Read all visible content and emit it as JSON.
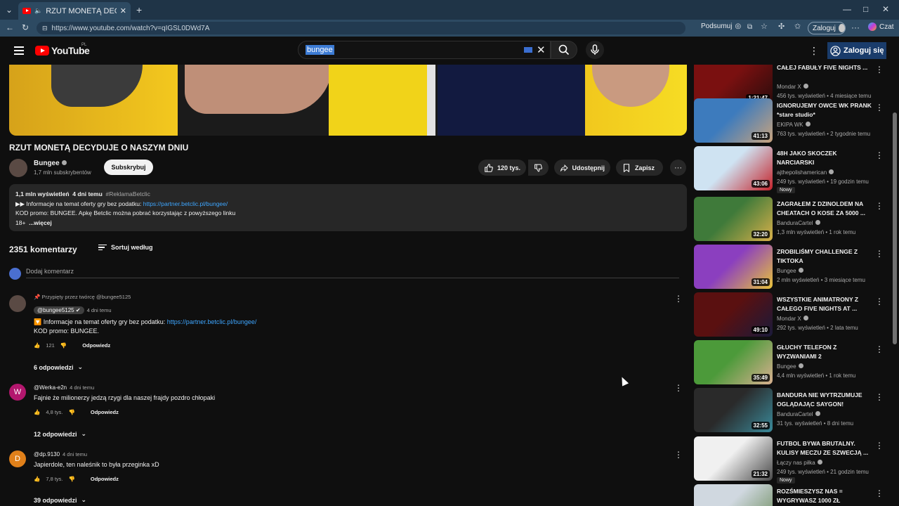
{
  "browser": {
    "tab_title": "RZUT MONETĄ DECYDUJE O",
    "url": "https://www.youtube.com/watch?v=qIGSL0DWd7A",
    "summarize": "Podsumuj",
    "login": "Zaloguj",
    "chat": "Czat"
  },
  "header": {
    "logo": "YouTube",
    "region": "PL",
    "search_value": "bungee",
    "sign_in": "Zaloguj się"
  },
  "video": {
    "title": "RZUT MONETĄ DECYDUJE O NASZYM DNIU",
    "channel": "Bungee",
    "subscribers": "1,7 mln subskrybentów",
    "subscribe": "Subskrybuj",
    "likes": "120 tys.",
    "share": "Udostępnij",
    "save": "Zapisz"
  },
  "description": {
    "views": "1,1 mln wyświetleń",
    "date": "4 dni temu",
    "hashtag": "#ReklamaBetclic",
    "line1_prefix": "▶▶ Informacje na temat oferty gry bez podatku: ",
    "line1_link": "https://partner.betclic.pl/bungee/",
    "line2": "KOD promo: BUNGEE. Apkę Betclic można pobrać korzystając z powyższego linku",
    "age": "18+",
    "more": "...więcej"
  },
  "comments": {
    "count": "2351 komentarzy",
    "sort": "Sortuj według",
    "add_placeholder": "Dodaj komentarz",
    "items": [
      {
        "pinned": "Przypięty przez twórcę @bungee5125",
        "author": "@bungee5125",
        "time": "4 dni temu",
        "text_prefix": "🔽 Informacje na temat oferty gry bez podatku: ",
        "text_link": "https://partner.betclic.pl/bungee/",
        "text_line2": "KOD promo: BUNGEE.",
        "likes": "121",
        "reply": "Odpowiedz",
        "replies": "6 odpowiedzi"
      },
      {
        "initial": "W",
        "author": "@Werka-e2n",
        "time": "4 dni temu",
        "text": "Fajnie że milionerzy jedzą rzygi dla naszej frajdy pozdro chłopaki",
        "likes": "4,8 tys.",
        "reply": "Odpowiedz",
        "replies": "12 odpowiedzi"
      },
      {
        "initial": "D",
        "author": "@dp.9130",
        "time": "4 dni temu",
        "text": "Japierdole, ten naleśnik to była przeginka xD",
        "likes": "7,8 tys.",
        "reply": "Odpowiedz",
        "replies": "39 odpowiedzi"
      }
    ]
  },
  "sidebar": [
    {
      "title": "CAŁEJ FABUŁY FIVE NIGHTS ...",
      "channel": "Mondar X",
      "meta": "456 tys. wyświetleń • 4 miesiące temu",
      "duration": "1:21:47",
      "thumb": [
        "#7a1010",
        "#2a0c0c"
      ],
      "new": ""
    },
    {
      "title": "IGNORUJEMY OWCE WK PRANK *stare studio*",
      "channel": "EKIPA WK",
      "meta": "763 tys. wyświetleń • 2 tygodnie temu",
      "duration": "41:13",
      "thumb": [
        "#3d7bbd",
        "#c9a37d"
      ],
      "new": ""
    },
    {
      "title": "48H JAKO SKOCZEK NARCIARSKI",
      "channel": "ajthepolishamerican",
      "meta": "249 tys. wyświetleń • 19 godzin temu",
      "duration": "43:06",
      "thumb": [
        "#cfe3f2",
        "#c4232b"
      ],
      "new": "Nowy"
    },
    {
      "title": "ZAGRAŁEM Z DZINOLDEM NA CHEATACH O KOSE ZA 5000 ...",
      "channel": "BanduraCartel",
      "meta": "1,3 mln wyświetleń • 1 rok temu",
      "duration": "32:20",
      "thumb": [
        "#3f7a3a",
        "#d8b04a"
      ],
      "new": ""
    },
    {
      "title": "ZROBILIŚMY CHALLENGE Z TIKTOKA",
      "channel": "Bungee",
      "meta": "2 mln wyświetleń • 3 miesiące temu",
      "duration": "31:04",
      "thumb": [
        "#8b3fbf",
        "#e8c33a"
      ],
      "new": ""
    },
    {
      "title": "WSZYSTKIE ANIMATRONY Z CAŁEGO FIVE NIGHTS AT ...",
      "channel": "Mondar X",
      "meta": "292 tys. wyświetleń • 2 lata temu",
      "duration": "49:10",
      "thumb": [
        "#5a1010",
        "#1a1a3a"
      ],
      "new": ""
    },
    {
      "title": "GŁUCHY TELEFON Z WYZWANIAMI 2",
      "channel": "Bungee",
      "meta": "4,4 mln wyświetleń • 1 rok temu",
      "duration": "35:49",
      "thumb": [
        "#4c9a3a",
        "#d9b090"
      ],
      "new": ""
    },
    {
      "title": "BANDURA NIE WYTRZUMUJE OGLĄDAJĄC SAYGON!",
      "channel": "BanduraCartel",
      "meta": "31 tys. wyświetleń • 8 dni temu",
      "duration": "32:55",
      "thumb": [
        "#2a2a2a",
        "#3a8a9a"
      ],
      "new": ""
    },
    {
      "title": "FUTBOL BYWA BRUTALNY. KULISY MECZU ZE SZWECJĄ ...",
      "channel": "Łączy nas piłka",
      "meta": "249 tys. wyświetleń • 21 godzin temu",
      "duration": "21:32",
      "thumb": [
        "#f0f0f0",
        "#4a4a4a"
      ],
      "new": "Nowy"
    },
    {
      "title": "ROZŚMIESZYSZ NAS = WYGRYWASZ 1000 ZŁ",
      "channel": "",
      "meta": "",
      "duration": "",
      "thumb": [
        "#d0d8e0",
        "#6a8a5a"
      ],
      "new": ""
    }
  ]
}
